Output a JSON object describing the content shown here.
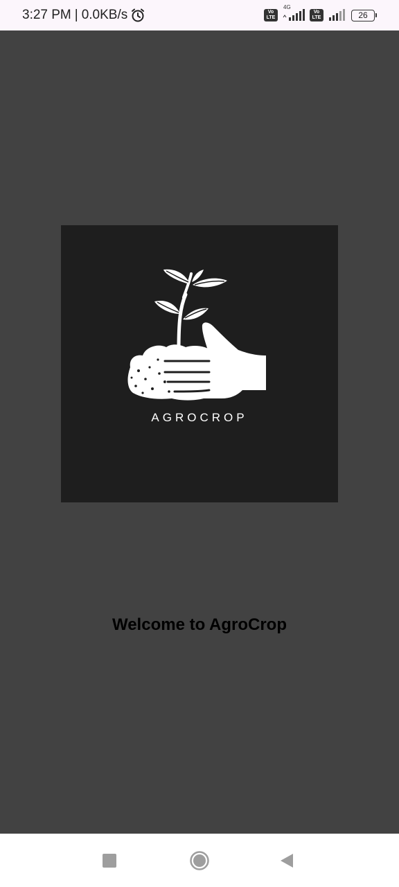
{
  "status_bar": {
    "time": "3:27 PM",
    "separator": "|",
    "network_speed": "0.0KB/s",
    "alarm_icon": "alarm-clock-icon",
    "sim1_badge": [
      "Vo",
      "LTE"
    ],
    "sim1_network": "4G",
    "sim2_badge": [
      "Vo",
      "LTE"
    ],
    "battery_level": "26"
  },
  "logo": {
    "brand_text": "AGROCROP",
    "icon": "hand-holding-sprout-icon",
    "background_color": "#1e1e1e"
  },
  "welcome": {
    "message": "Welcome to AgroCrop"
  },
  "nav_bar": {
    "recents_icon": "square-icon",
    "home_icon": "circle-icon",
    "back_icon": "triangle-back-icon"
  },
  "colors": {
    "screen_background": "#424242",
    "status_bar_background": "#fcf6fc",
    "nav_bar_background": "#ffffff"
  }
}
